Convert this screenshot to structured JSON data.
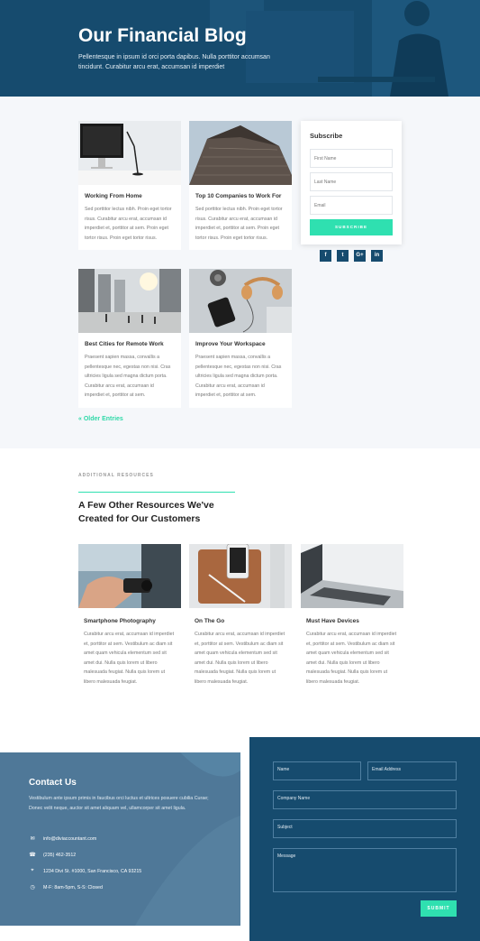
{
  "hero": {
    "title": "Our Financial Blog",
    "subtitle": "Pellentesque in ipsum id orci porta dapibus. Nulla porttitor accumsan tincidunt. Curabitur arcu erat, accumsan id imperdiet"
  },
  "blog": {
    "posts": [
      {
        "title": "Working From Home",
        "excerpt": "Sed porttitor lectus nibh. Proin eget tortor risus. Curabitur arcu erat, accumsan id imperdiet et, porttitor at sem. Proin eget tortor risus. Proin eget tortor risus."
      },
      {
        "title": "Top 10 Companies to Work For",
        "excerpt": "Sed porttitor lectus nibh. Proin eget tortor risus. Curabitur arcu erat, accumsan id imperdiet et, porttitor at sem. Proin eget tortor risus. Proin eget tortor risus."
      },
      {
        "title": "Best Cities for Remote Work",
        "excerpt": "Praesent sapien massa, convallis a pellentesque nec, egestas non nisi. Cras ultricies ligula sed magna dictum porta. Curabitur arcu erat, accumsan id imperdiet et, porttitor at sem."
      },
      {
        "title": "Improve Your Workspace",
        "excerpt": "Praesent sapien massa, convallis a pellentesque nec, egestas non nisi. Cras ultricies ligula sed magna dictum porta. Curabitur arcu erat, accumsan id imperdiet et, porttitor at sem."
      }
    ],
    "older_entries": "« Older Entries"
  },
  "subscribe": {
    "title": "Subscribe",
    "first_name_placeholder": "First Name",
    "last_name_placeholder": "Last Name",
    "email_placeholder": "Email",
    "button_label": "SUBSCRIBE",
    "social": [
      "f",
      "t",
      "G+",
      "in"
    ]
  },
  "resources": {
    "eyebrow": "ADDITIONAL RESOURCES",
    "heading": "A Few Other Resources We've Created for Our Customers",
    "items": [
      {
        "title": "Smartphone Photography",
        "text": "Curabitur arcu erat, accumsan id imperdiet et, porttitor at sem. Vestibulum ac diam sit amet quam vehicula elementum sed sit amet dui. Nulla quis lorem ut libero malesuada feugiat. Nulla quis lorem ut libero malesuada feugiat."
      },
      {
        "title": "On The Go",
        "text": "Curabitur arcu erat, accumsan id imperdiet et, porttitor at sem. Vestibulum ac diam sit amet quam vehicula elementum sed sit amet dui. Nulla quis lorem ut libero malesuada feugiat. Nulla quis lorem ut libero malesuada feugiat."
      },
      {
        "title": "Must Have Devices",
        "text": "Curabitur arcu erat, accumsan id imperdiet et, porttitor at sem. Vestibulum ac diam sit amet quam vehicula elementum sed sit amet dui. Nulla quis lorem ut libero malesuada feugiat. Nulla quis lorem ut libero malesuada feugiat."
      }
    ]
  },
  "contact": {
    "title": "Contact Us",
    "text": "Vestibulum ante ipsum primis in faucibus orci luctus et ultrices posuere cubilia Curae; Donec velit neque, auctor sit amet aliquam vel, ullamcorper sit amet ligula.",
    "email": "info@diviaccountant.com",
    "phone": "(235) 462-3512",
    "address": "1234 Divi St. #1000, San Francisco, CA 93215",
    "hours": "M-F: 8am-5pm, S-S: Closed"
  },
  "form": {
    "name_placeholder": "Name",
    "email_placeholder": "Email Address",
    "company_placeholder": "Company Name",
    "subject_placeholder": "Subject",
    "message_placeholder": "Message",
    "submit_label": "SUBMIT"
  },
  "colors": {
    "brand_dark": "#164b6e",
    "accent": "#2fe0b0",
    "contact_bg": "#4f7898"
  }
}
